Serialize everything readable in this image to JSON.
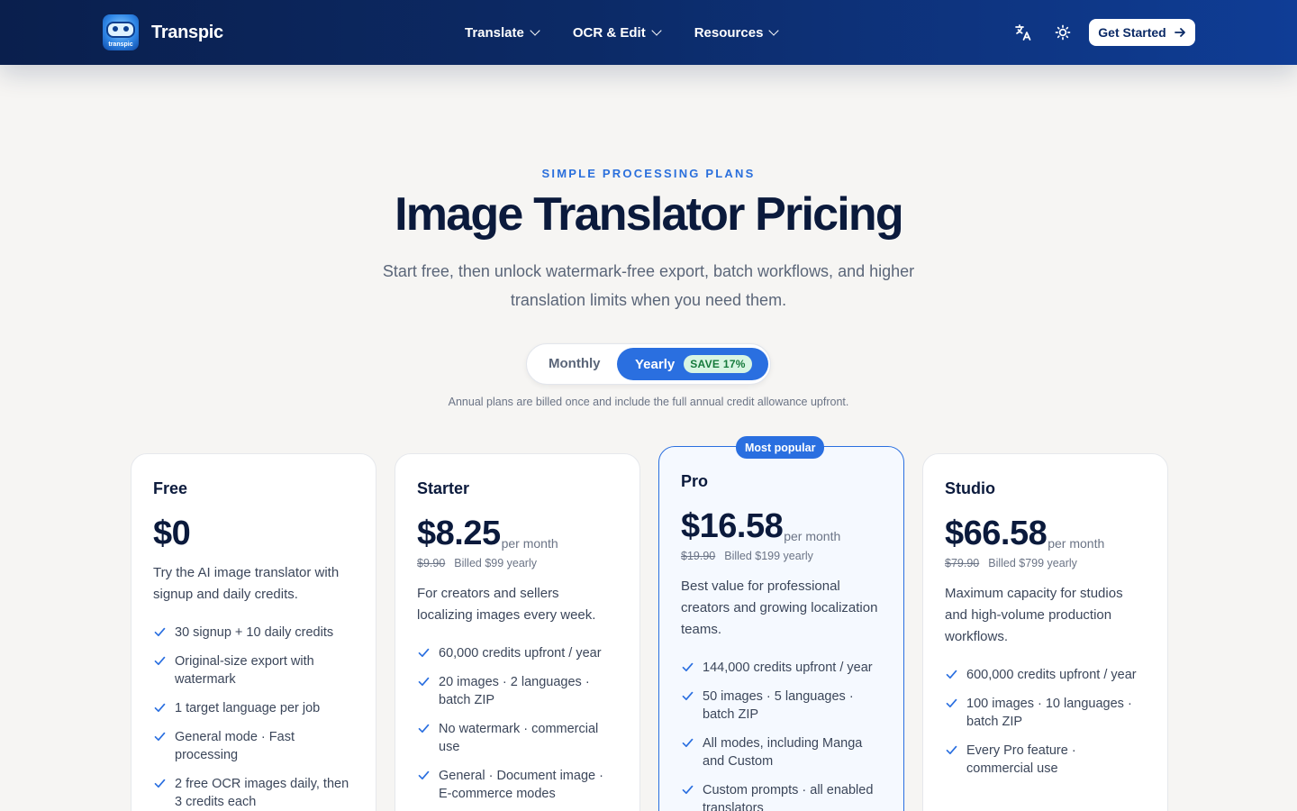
{
  "nav": {
    "brand": "Transpic",
    "logo_text": "transpic",
    "menu": [
      {
        "label": "Translate"
      },
      {
        "label": "OCR & Edit"
      },
      {
        "label": "Resources"
      }
    ],
    "icons": [
      "translate-icon",
      "sun-icon"
    ],
    "cta_label": "Get Started"
  },
  "hero": {
    "eyebrow": "SIMPLE PROCESSING PLANS",
    "title": "Image Translator Pricing",
    "subtitle": "Start free, then unlock watermark-free export, batch workflows, and higher translation limits when you need them."
  },
  "billing_toggle": {
    "monthly": "Monthly",
    "yearly": "Yearly",
    "save_badge": "SAVE 17%",
    "selected": "Yearly",
    "note": "Annual plans are billed once and include the full annual credit allowance upfront."
  },
  "plans": [
    {
      "name": "Free",
      "price": "$0",
      "description": "Try the AI image translator with signup and daily credits.",
      "features": [
        "30 signup + 10 daily credits",
        "Original-size export with watermark",
        "1 target language per job",
        "General mode · Fast processing",
        "2 free OCR images daily, then 3 credits each"
      ]
    },
    {
      "name": "Starter",
      "price": "$8.25",
      "per": "per month",
      "old_price": "$9.90",
      "billed": "Billed $99 yearly",
      "description": "For creators and sellers localizing images every week.",
      "features": [
        "60,000 credits upfront / year",
        "20 images · 2 languages · batch ZIP",
        "No watermark · commercial use",
        "General · Document image · E-commerce modes"
      ]
    },
    {
      "name": "Pro",
      "badge": "Most popular",
      "price": "$16.58",
      "per": "per month",
      "old_price": "$19.90",
      "billed": "Billed $199 yearly",
      "description": "Best value for professional creators and growing localization teams.",
      "features": [
        "144,000 credits upfront / year",
        "50 images · 5 languages · batch ZIP",
        "All modes, including Manga and Custom",
        "Custom prompts · all enabled translators"
      ]
    },
    {
      "name": "Studio",
      "price": "$66.58",
      "per": "per month",
      "old_price": "$79.90",
      "billed": "Billed $799 yearly",
      "description": "Maximum capacity for studios and high-volume production workflows.",
      "features": [
        "600,000 credits upfront / year",
        "100 images · 10 languages · batch ZIP",
        "Every Pro feature · commercial use"
      ]
    }
  ],
  "colors": {
    "accent": "#2a6fe0",
    "nav_start": "#0a1f4d",
    "nav_end": "#0f3d96",
    "heading": "#0b1a3c",
    "background": "#f6f5f3"
  }
}
